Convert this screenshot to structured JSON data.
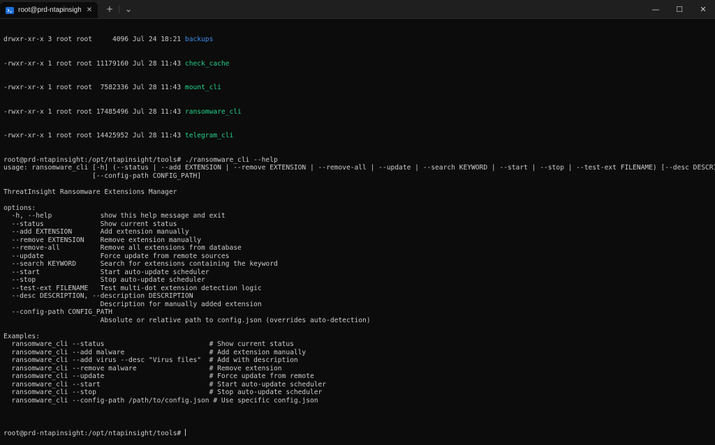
{
  "window": {
    "tab_title": "root@prd-ntapinsight: /opt/n",
    "new_tab_label": "+",
    "dropdown_label": "⌄",
    "minimize_label": "—",
    "maximize_label": "☐",
    "close_label": "✕",
    "tab_close_label": "✕",
    "icons": {
      "tab": "terminal-icon",
      "new_tab": "plus-icon",
      "dropdown": "chevron-down-icon"
    }
  },
  "colors": {
    "background": "#0c0c0c",
    "text": "#cccccc",
    "directory": "#3b8eea",
    "executable": "#23d18b"
  },
  "listing": [
    {
      "meta": "drwxr-xr-x 3 root root     4096 Jul 24 18:21 ",
      "name": "backups",
      "kind": "dir"
    },
    {
      "meta": "-rwxr-xr-x 1 root root 11179160 Jul 28 11:43 ",
      "name": "check_cache",
      "kind": "exe"
    },
    {
      "meta": "-rwxr-xr-x 1 root root  7582336 Jul 28 11:43 ",
      "name": "mount_cli",
      "kind": "exe"
    },
    {
      "meta": "-rwxr-xr-x 1 root root 17485496 Jul 28 11:43 ",
      "name": "ransomware_cli",
      "kind": "exe"
    },
    {
      "meta": "-rwxr-xr-x 1 root root 14425952 Jul 28 11:43 ",
      "name": "telegram_cli",
      "kind": "exe"
    }
  ],
  "output_lines": [
    "root@prd-ntapinsight:/opt/ntapinsight/tools# ./ransomware_cli --help",
    "usage: ransomware_cli [-h] (--status | --add EXTENSION | --remove EXTENSION | --remove-all | --update | --search KEYWORD | --start | --stop | --test-ext FILENAME) [--desc DESCRIPTION]",
    "                      [--config-path CONFIG_PATH]",
    "",
    "ThreatInsight Ransomware Extensions Manager",
    "",
    "options:",
    "  -h, --help            show this help message and exit",
    "  --status              Show current status",
    "  --add EXTENSION       Add extension manually",
    "  --remove EXTENSION    Remove extension manually",
    "  --remove-all          Remove all extensions from database",
    "  --update              Force update from remote sources",
    "  --search KEYWORD      Search for extensions containing the keyword",
    "  --start               Start auto-update scheduler",
    "  --stop                Stop auto-update scheduler",
    "  --test-ext FILENAME   Test multi-dot extension detection logic",
    "  --desc DESCRIPTION, --description DESCRIPTION",
    "                        Description for manually added extension",
    "  --config-path CONFIG_PATH",
    "                        Absolute or relative path to config.json (overrides auto-detection)",
    "",
    "Examples:",
    "  ransomware_cli --status                          # Show current status",
    "  ransomware_cli --add malware                     # Add extension manually",
    "  ransomware_cli --add virus --desc \"Virus files\"  # Add with description",
    "  ransomware_cli --remove malware                  # Remove extension",
    "  ransomware_cli --update                          # Force update from remote",
    "  ransomware_cli --start                           # Start auto-update scheduler",
    "  ransomware_cli --stop                            # Stop auto-update scheduler",
    "  ransomware_cli --config-path /path/to/config.json # Use specific config.json",
    ""
  ],
  "prompt": "root@prd-ntapinsight:/opt/ntapinsight/tools# "
}
